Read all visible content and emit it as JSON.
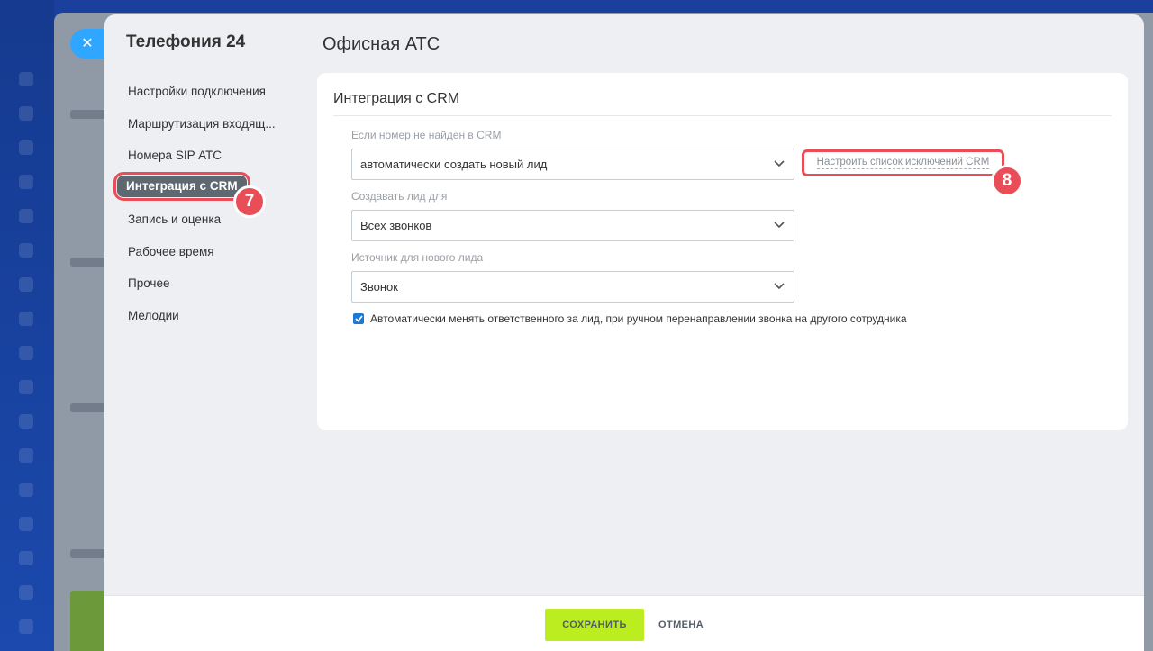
{
  "app": {
    "title": "Телефония 24"
  },
  "page": {
    "title": "Офисная АТС"
  },
  "sidebar": {
    "items": [
      {
        "label": "Настройки подключения"
      },
      {
        "label": "Маршрутизация входящ..."
      },
      {
        "label": "Номера SIP АТС"
      },
      {
        "label": "Интеграция с CRM",
        "active": true
      },
      {
        "label": "Запись и оценка"
      },
      {
        "label": "Рабочее время"
      },
      {
        "label": "Прочее"
      },
      {
        "label": "Мелодии"
      }
    ]
  },
  "badges": {
    "first": "7",
    "second": "8"
  },
  "card": {
    "title": "Интеграция с CRM",
    "not_found": {
      "label": "Если номер не найден в CRM",
      "value": "автоматически создать новый лид"
    },
    "exceptions_link": "Настроить список исключений CRM",
    "create_for": {
      "label": "Создавать лид для",
      "value": "Всех звонков"
    },
    "source": {
      "label": "Источник для нового лида",
      "value": "Звонок"
    },
    "auto_change": {
      "label": "Автоматически менять ответственного за лид, при ручном перенаправлении звонка на другого сотрудника",
      "checked": true
    }
  },
  "footer": {
    "save": "СОХРАНИТЬ",
    "cancel": "ОТМЕНА"
  },
  "colors": {
    "accent": "#2fa6ff",
    "highlight": "#e94d57",
    "save": "#bbed21",
    "checkbox": "#1f78d1"
  },
  "icons": {
    "close": "close-icon",
    "dropdown": "chevron-down-icon",
    "check": "check-icon"
  }
}
